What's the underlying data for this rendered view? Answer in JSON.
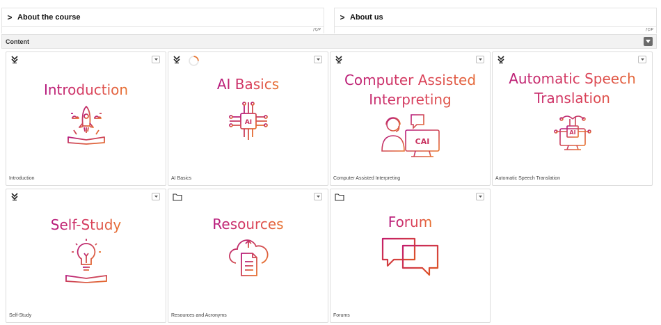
{
  "sections": {
    "about_course": {
      "title": "About the course",
      "chevron": ">",
      "skip": "ƒÇ/P"
    },
    "about_us": {
      "title": "About us",
      "chevron": ">",
      "skip": "ƒÇ/P"
    }
  },
  "content": {
    "title": "Content",
    "collapse_icon": "caret-down-icon"
  },
  "colors": {
    "accent_pink": "#b5187e",
    "accent_orange": "#e8732d",
    "card_border": "#dcdcdc",
    "header_bg": "#f2f2f2"
  },
  "cards": [
    {
      "heading": "Introduction",
      "caption": "Introduction",
      "icon": "collapse-chevrons-icon",
      "art": "rocket-book-icon"
    },
    {
      "heading": "AI Basics",
      "caption": "AI Basics",
      "icon": "collapse-chevrons-icon",
      "art": "ai-chip-icon",
      "loading": true
    },
    {
      "heading_line1": "Computer Assisted",
      "heading_line2": "Interpreting",
      "caption": "Computer Assisted Interpreting",
      "icon": "collapse-chevrons-icon",
      "art": "interpreter-monitor-icon",
      "badge": "CAI"
    },
    {
      "heading_line1": "Automatic Speech",
      "heading_line2": "Translation",
      "caption": "Automatic Speech Translation",
      "icon": "collapse-chevrons-icon",
      "art": "ai-monitor-icon",
      "badge": "AI"
    },
    {
      "heading": "Self-Study",
      "caption": "Self-Study",
      "icon": "collapse-chevrons-icon",
      "art": "lightbulb-book-icon"
    },
    {
      "heading": "Resources",
      "caption": "Resources and Acronyms",
      "icon": "folder-icon",
      "art": "cloud-document-icon"
    },
    {
      "heading": "Forum",
      "caption": "Forums",
      "icon": "folder-icon",
      "art": "chat-bubbles-icon"
    }
  ]
}
